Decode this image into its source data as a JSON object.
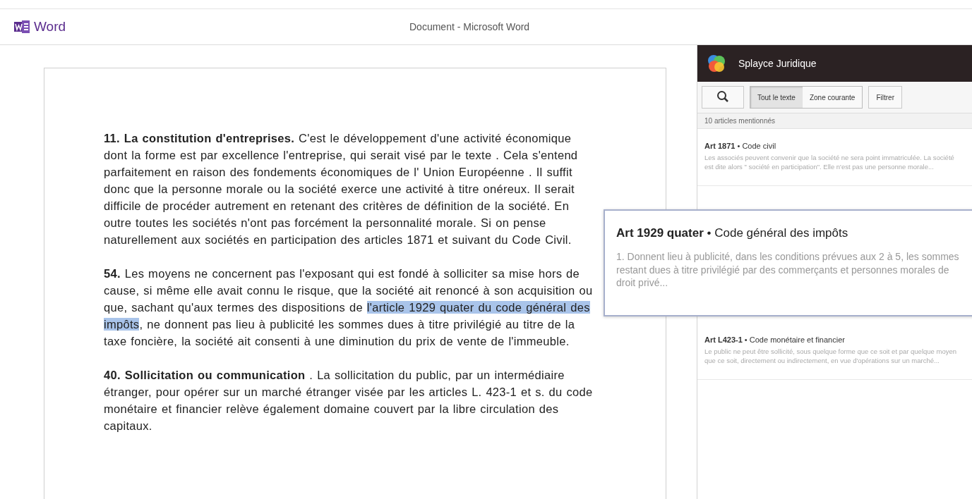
{
  "app": {
    "name": "Word",
    "title": "Document - Microsoft Word"
  },
  "document": {
    "paragraphs": [
      [
        {
          "text": "**11. La constitution d'entreprises.** C'est le développement d'une activité économique dont la forme est par excellence l'entreprise, qui serait visé par le texte . Cela s'entend parfaitement en raison des fondements économiques de l' Union Européenne . Il suffit donc que la personne morale ou la société exerce une activité à titre onéreux. Il serait difficile de procéder autrement en retenant des critères de définition de la société. En outre toutes les sociétés n'ont pas forcément la personnalité morale. Si on pense naturellement aux sociétés en participation des articles 1871 et suivant du Code Civil.",
          "selected": false
        }
      ],
      [
        {
          "text": "**54.** Les moyens ne concernent pas l'exposant qui est fondé à solliciter sa mise hors de cause, si même elle avait connu le risque, que la société ait renoncé à son acquisition ou que, sachant qu'aux termes des dispositions de ",
          "selected": false
        },
        {
          "text": "l'article 1929 quater du code général des impôts",
          "selected": true
        },
        {
          "text": ", ne donnent pas lieu à publicité les sommes dues à titre privilégié au titre de la taxe foncière, la société ait consenti à une diminution du prix de vente de l'immeuble.",
          "selected": false
        }
      ],
      [
        {
          "text": "**40. Sollicitation ou communication** . La sollicitation du public, par un intermédiaire étranger, pour opérer sur un marché étranger visée par les articles L. 423-1 et s. du code monétaire et financier relève également domaine couvert par la libre circulation des capitaux.",
          "selected": false
        }
      ]
    ]
  },
  "panel": {
    "title": "Splayce Juridique",
    "scopes": [
      {
        "label": "Tout le texte",
        "selected": true
      },
      {
        "label": "Zone courante",
        "selected": false
      }
    ],
    "filter": "Filtrer",
    "count": "10 articles mentionnés",
    "articles": [
      {
        "article": "Art 1871",
        "separator": "•",
        "code": "Code civil",
        "excerpt": "Les associés peuvent convenir que la société ne sera point immatriculée. La société est dite alors \" société en participation\". Elle n'est pas une personne morale..."
      },
      {
        "article": "Art L423-1",
        "separator": "•",
        "code": "Code monétaire et financier",
        "excerpt": "Le public ne peut être sollicité, sous quelque forme que ce soit et par quelque moyen que ce soit, directement ou indirectement, en vue d'opérations sur un marché..."
      }
    ]
  },
  "popup": {
    "article": "Art 1929 quater",
    "separator": "•",
    "code": "Code général des impôts",
    "excerpt": "1. Donnent lieu à publicité, dans les conditions prévues aux 2 à 5, les sommes restant dues à titre privilégié par des commerçants et personnes morales de droit privé..."
  }
}
